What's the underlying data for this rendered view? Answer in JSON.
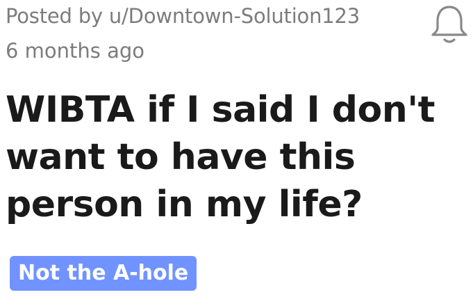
{
  "post": {
    "posted_by": "Posted by u/Downtown-Solution123",
    "timestamp": "6 months ago",
    "title": "WIBTA if I said I don't want to have this person in my life?",
    "flair": {
      "label": "Not the A-hole",
      "background_color": "#7193ff",
      "text_color": "#ffffff"
    },
    "notification_icon": "bell-icon"
  }
}
